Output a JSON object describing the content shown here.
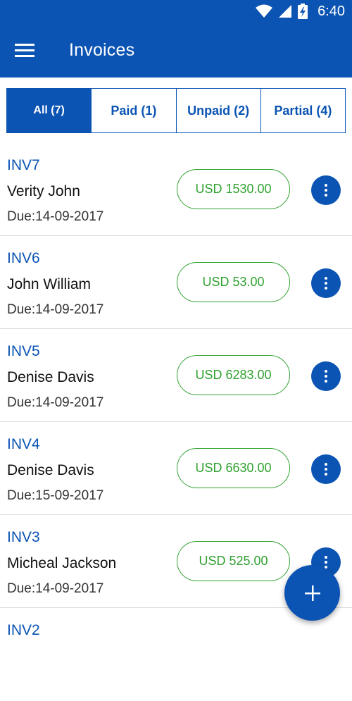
{
  "status_bar": {
    "time": "6:40"
  },
  "app_bar": {
    "title": "Invoices"
  },
  "tabs": [
    {
      "label": "All (7)",
      "active": true
    },
    {
      "label": "Paid (1)",
      "active": false
    },
    {
      "label": "Unpaid (2)",
      "active": false
    },
    {
      "label": "Partial (4)",
      "active": false
    }
  ],
  "invoices": [
    {
      "id": "INV7",
      "client": "Verity John",
      "due": "Due:14-09-2017",
      "amount": "USD 1530.00"
    },
    {
      "id": "INV6",
      "client": "John William",
      "due": "Due:14-09-2017",
      "amount": "USD 53.00"
    },
    {
      "id": "INV5",
      "client": "Denise Davis",
      "due": "Due:14-09-2017",
      "amount": "USD 6283.00"
    },
    {
      "id": "INV4",
      "client": "Denise Davis",
      "due": "Due:15-09-2017",
      "amount": "USD 6630.00"
    },
    {
      "id": "INV3",
      "client": "Micheal Jackson",
      "due": "Due:14-09-2017",
      "amount": "USD 525.00"
    },
    {
      "id": "INV2"
    }
  ],
  "colors": {
    "primary": "#0b54b3",
    "amount_green": "#2fa12f",
    "divider": "#dcdcdc"
  },
  "icons": {
    "wifi": "wifi-icon",
    "signal": "signal-icon",
    "battery": "battery-charging-icon",
    "menu": "hamburger-menu-icon",
    "more": "more-vertical-icon",
    "add": "plus-icon"
  }
}
